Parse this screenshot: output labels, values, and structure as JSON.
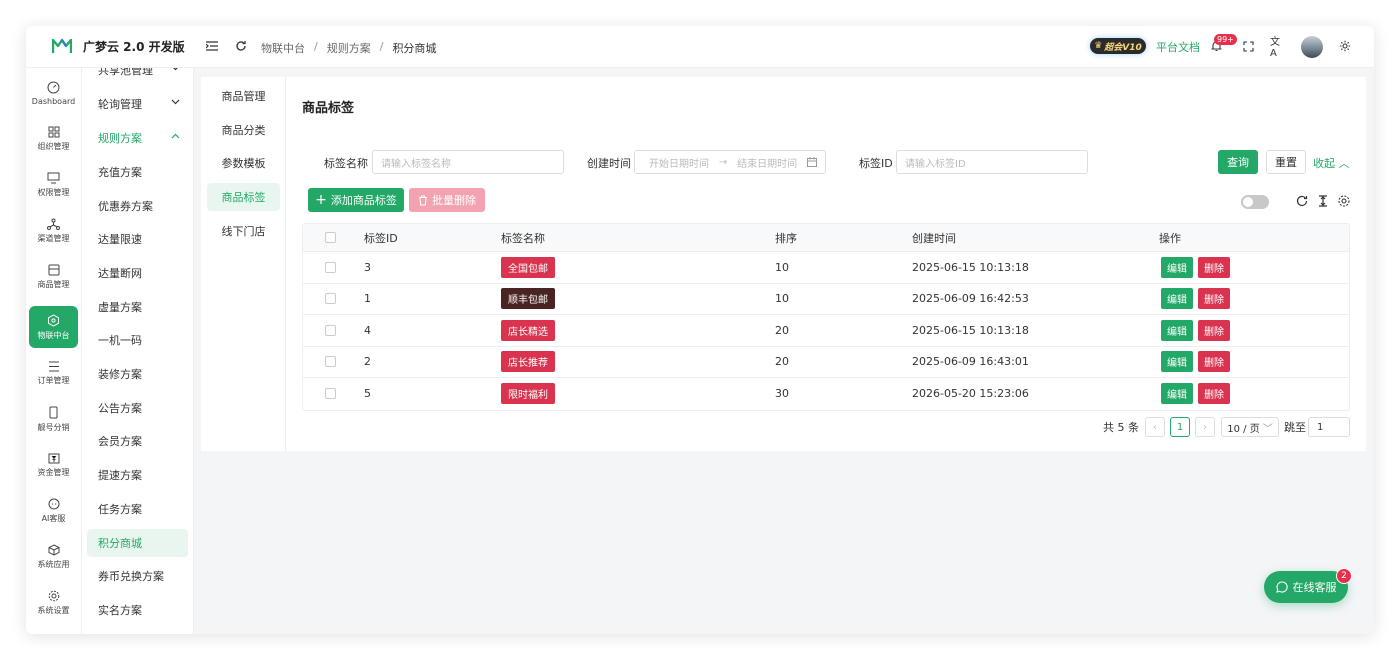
{
  "app": {
    "title": "广梦云 2.0 开发版"
  },
  "breadcrumb": [
    "物联中台",
    "规则方案",
    "积分商城"
  ],
  "header": {
    "vip_label": "超会V10",
    "doc_link": "平台文档",
    "notification_count": "99+"
  },
  "rail": [
    {
      "label": "Dashboard",
      "icon": "dashboard-icon"
    },
    {
      "label": "组织管理",
      "icon": "grid-icon"
    },
    {
      "label": "权限管理",
      "icon": "monitor-icon"
    },
    {
      "label": "渠道管理",
      "icon": "network-icon"
    },
    {
      "label": "商品管理",
      "icon": "store-icon"
    },
    {
      "label": "物联中台",
      "icon": "hub-icon",
      "active": true
    },
    {
      "label": "订单管理",
      "icon": "list-icon"
    },
    {
      "label": "靓号分销",
      "icon": "phone-icon"
    },
    {
      "label": "资金管理",
      "icon": "money-icon"
    },
    {
      "label": "AI客服",
      "icon": "chat-icon"
    },
    {
      "label": "系统应用",
      "icon": "cube-icon"
    },
    {
      "label": "系统设置",
      "icon": "gear-icon"
    }
  ],
  "submenu": [
    {
      "label": "共享池管理",
      "chevron": "down"
    },
    {
      "label": "轮询管理",
      "chevron": "down"
    },
    {
      "label": "规则方案",
      "chevron": "up",
      "open": true
    },
    {
      "label": "充值方案"
    },
    {
      "label": "优惠券方案"
    },
    {
      "label": "达量限速"
    },
    {
      "label": "达量断网"
    },
    {
      "label": "虚量方案"
    },
    {
      "label": "一机一码"
    },
    {
      "label": "装修方案"
    },
    {
      "label": "公告方案"
    },
    {
      "label": "会员方案"
    },
    {
      "label": "提速方案"
    },
    {
      "label": "任务方案"
    },
    {
      "label": "积分商城",
      "active": true
    },
    {
      "label": "券币兑换方案"
    },
    {
      "label": "实名方案"
    }
  ],
  "tabs": [
    {
      "label": "商品管理"
    },
    {
      "label": "商品分类"
    },
    {
      "label": "参数模板"
    },
    {
      "label": "商品标签",
      "active": true
    },
    {
      "label": "线下门店"
    }
  ],
  "page": {
    "title": "商品标签"
  },
  "filters": {
    "tag_name_label": "标签名称",
    "tag_name_placeholder": "请输入标签名称",
    "created_label": "创建时间",
    "start_placeholder": "开始日期时间",
    "end_placeholder": "结束日期时间",
    "tag_id_label": "标签ID",
    "tag_id_placeholder": "请输入标签ID",
    "query_button": "查询",
    "reset_button": "重置",
    "collapse_link": "收起"
  },
  "toolbar": {
    "add_button": "添加商品标签",
    "batch_delete_button": "批量删除"
  },
  "table": {
    "columns": [
      "标签ID",
      "标签名称",
      "排序",
      "创建时间",
      "操作"
    ],
    "rows": [
      {
        "id": "3",
        "name": "全国包邮",
        "color": "#d9334f",
        "sort": "10",
        "created": "2025-06-15 10:13:18"
      },
      {
        "id": "1",
        "name": "顺丰包邮",
        "color": "#4a2323",
        "sort": "10",
        "created": "2025-06-09 16:42:53"
      },
      {
        "id": "4",
        "name": "店长精选",
        "color": "#d9334f",
        "sort": "20",
        "created": "2025-06-15 10:13:18"
      },
      {
        "id": "2",
        "name": "店长推荐",
        "color": "#d9334f",
        "sort": "20",
        "created": "2025-06-09 16:43:01"
      },
      {
        "id": "5",
        "name": "限时福利",
        "color": "#d9334f",
        "sort": "30",
        "created": "2026-05-20 15:23:06"
      }
    ],
    "edit_label": "编辑",
    "delete_label": "删除"
  },
  "pagination": {
    "total_text": "共 5 条",
    "current_page": "1",
    "page_size": "10 / 页",
    "jump_label": "跳至",
    "jump_value": "1"
  },
  "service": {
    "label": "在线客服",
    "badge": "2"
  },
  "colors": {
    "accent": "#23a867",
    "danger": "#d9334f"
  }
}
